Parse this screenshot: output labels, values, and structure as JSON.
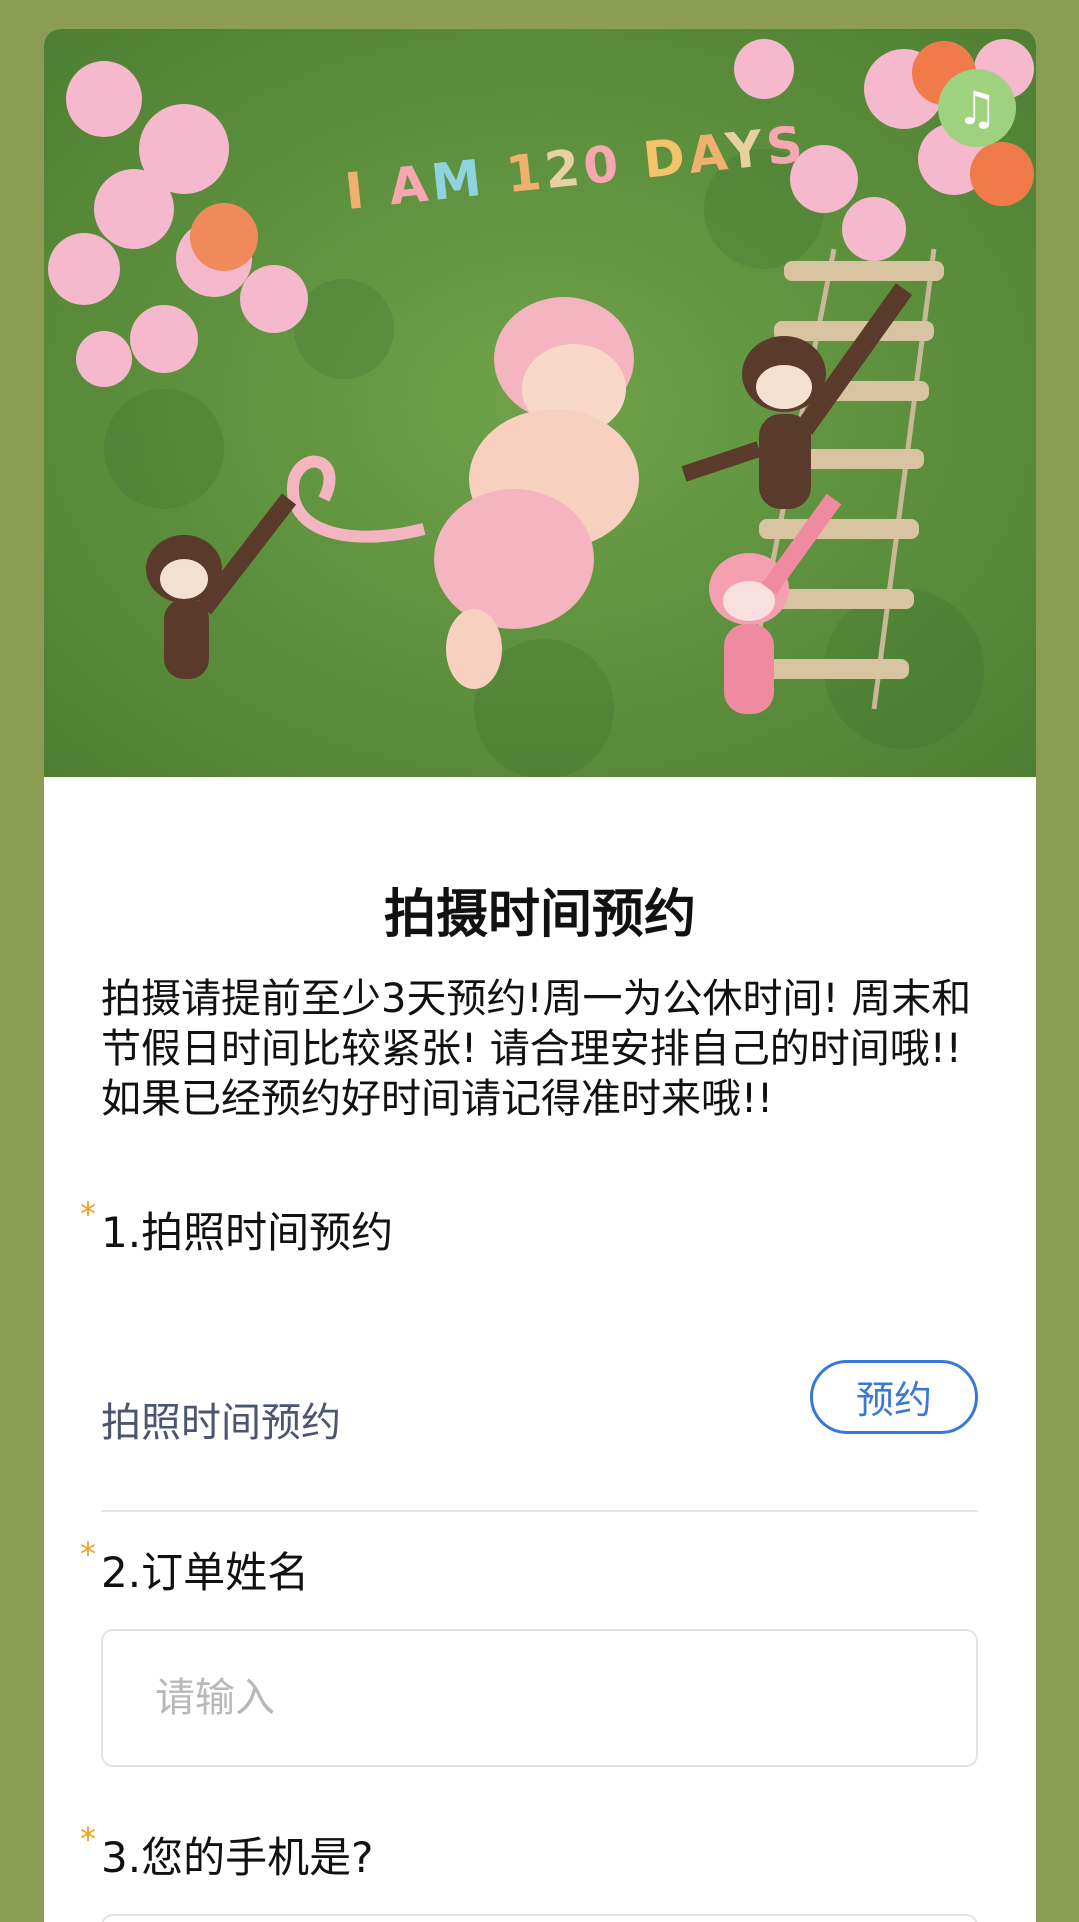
{
  "hero": {
    "caption": "I AM 120 DAYS",
    "music_icon": "music-note-icon"
  },
  "form": {
    "title": "拍摄时间预约",
    "description": [
      "拍摄请提前至少3天预约!周一为公休时间! 周末和节假日时间比较紧张! 请合理安排自己的时间哦!!",
      "如果已经预约好时间请记得准时来哦!!"
    ],
    "questions": [
      {
        "label": "1.拍照时间预约",
        "required_mark": "*",
        "value_text": "拍照时间预约",
        "button": "预约"
      },
      {
        "label": "2.订单姓名",
        "required_mark": "*",
        "placeholder": "请输入"
      },
      {
        "label": "3.您的手机是?",
        "required_mark": "*"
      }
    ]
  },
  "colors": {
    "background": "#8a9d52",
    "accent": "#3a78d8",
    "required": "#f0a020"
  }
}
